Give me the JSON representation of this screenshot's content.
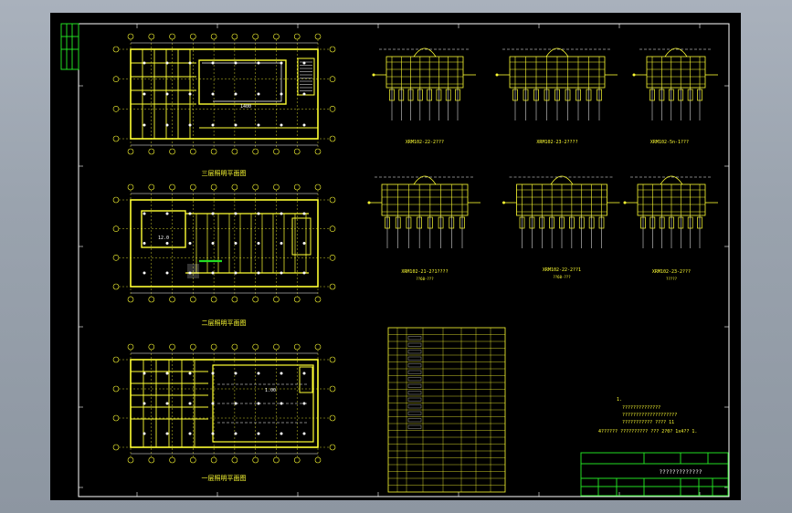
{
  "plans": {
    "floor3": {
      "title": "三层照明平面图",
      "room": "1400"
    },
    "floor2": {
      "title": "二层照明平面图",
      "room": "12.0"
    },
    "floor1": {
      "title": "一层照明平面图",
      "room": "1.00"
    }
  },
  "panels": [
    {
      "name": "XRM102-22-2???",
      "sub": ""
    },
    {
      "name": "XRM102-23-2????",
      "sub": ""
    },
    {
      "name": "XRM102-5n-1???",
      "sub": ""
    },
    {
      "name": "XRM102-21-2?1????",
      "sub": "??60-???"
    },
    {
      "name": "XRM102-22-2??1",
      "sub": "??60-???"
    },
    {
      "name": "XRM102-23-2???",
      "sub": "?????"
    }
  ],
  "notes": {
    "lines": [
      "1.",
      "??????????????",
      "????????????????????",
      "??????????? ???? 11",
      "4?????? ?????????? ??? 2?0? 1x4?? 1."
    ]
  },
  "title_block": {
    "project": "?????????????"
  },
  "colors": {
    "line": "#ffff33",
    "border": "#ffffff",
    "frame": "#22dd22",
    "accent": "#00ffff"
  }
}
